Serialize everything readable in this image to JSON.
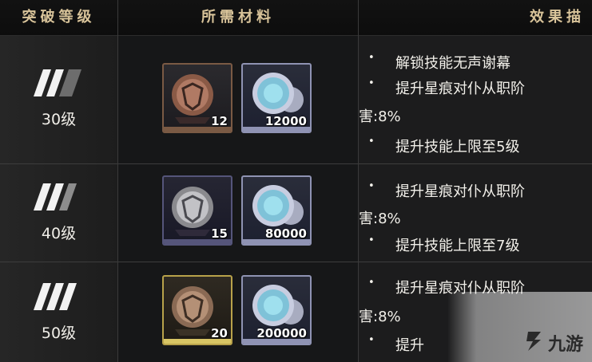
{
  "header": {
    "col1": "突破等级",
    "col2": "所需材料",
    "col3": "效果描"
  },
  "rows": [
    {
      "level": "30级",
      "materials": [
        {
          "icon": "bronze-shield-medal-icon",
          "qty": "12",
          "frame": "#7a5a44"
        },
        {
          "icon": "silver-coin-icon",
          "qty": "12000",
          "frame": "#8f93b3"
        }
      ],
      "effects": [
        {
          "text": "解锁技能无声谢幕",
          "bullet": true
        },
        {
          "text": "提升星痕对仆从职阶",
          "bullet": true
        },
        {
          "text": "害:8%",
          "bullet": false
        },
        {
          "text": "提升技能上限至5级",
          "bullet": true
        }
      ]
    },
    {
      "level": "40级",
      "materials": [
        {
          "icon": "silver-shield-medal-icon",
          "qty": "15",
          "frame": "#55557a"
        },
        {
          "icon": "silver-coin-icon",
          "qty": "80000",
          "frame": "#8f93b3"
        }
      ],
      "effects": [
        {
          "text": "提升星痕对仆从职阶",
          "bullet": true
        },
        {
          "text": "害:8%",
          "bullet": false
        },
        {
          "text": "提升技能上限至7级",
          "bullet": true
        }
      ]
    },
    {
      "level": "50级",
      "materials": [
        {
          "icon": "gold-shield-medal-icon",
          "qty": "20",
          "frame": "#b8a24a"
        },
        {
          "icon": "silver-coin-icon",
          "qty": "200000",
          "frame": "#8f93b3"
        }
      ],
      "effects": [
        {
          "text": "提升星痕对仆从职阶",
          "bullet": true
        },
        {
          "text": "害:8%",
          "bullet": false
        },
        {
          "text": "提升",
          "bullet": true
        }
      ]
    }
  ],
  "watermark": {
    "brand": "九游",
    "icon": "jiuyou-logo-icon"
  },
  "bullet_char": "•"
}
